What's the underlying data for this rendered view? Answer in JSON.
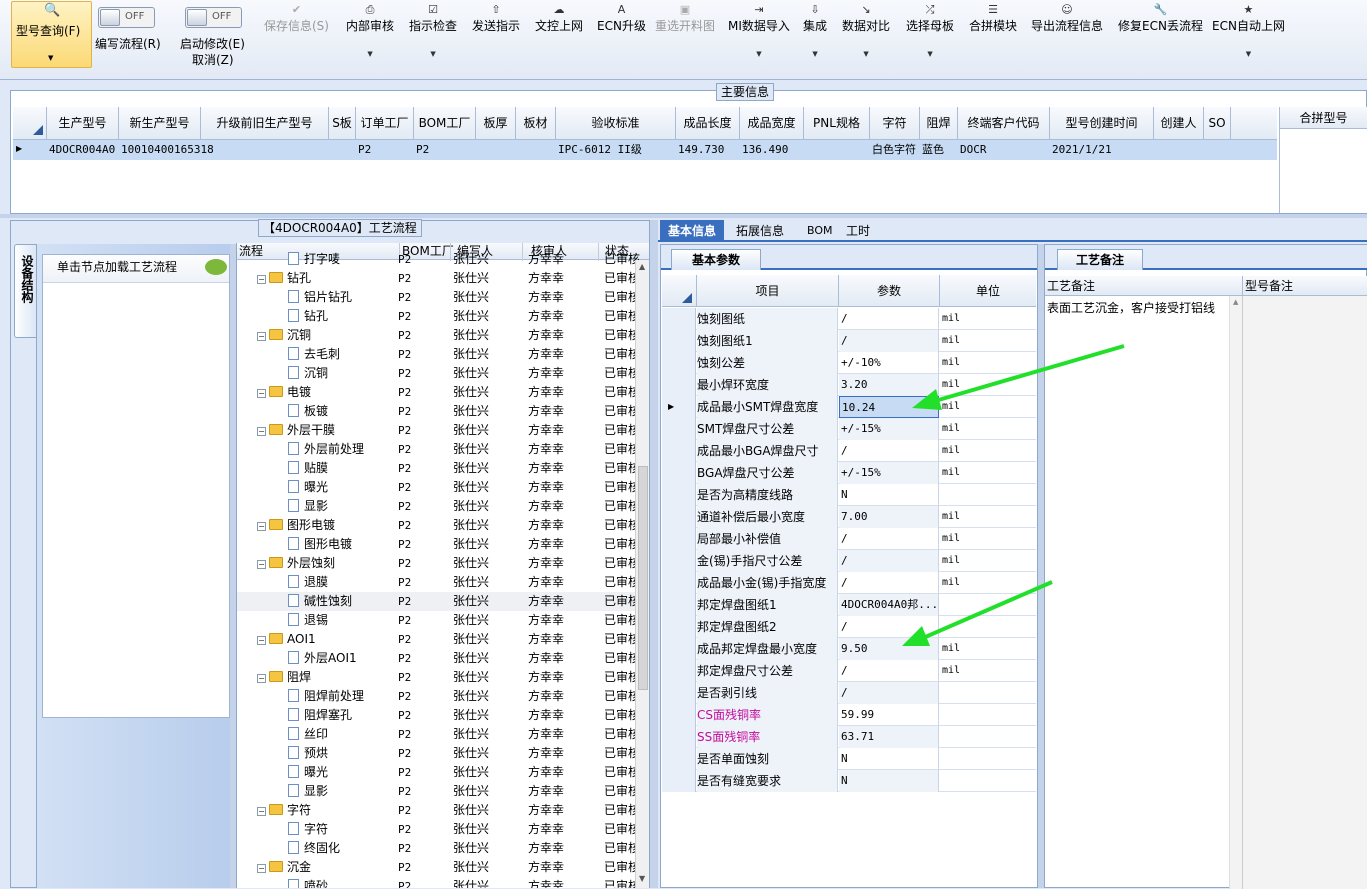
{
  "toolbar": {
    "query": "型号查询(F)",
    "edit_flow": "编写流程(R)",
    "start_modify": "启动修改(E)",
    "cancel": "取消(Z)",
    "toggle_off": "OFF",
    "buttons": [
      "保存信息(S)",
      "内部审核",
      "指示检查",
      "发送指示",
      "文控上网",
      "ECN升级",
      "重选开料图",
      "MI数据导入",
      "集成",
      "数据对比",
      "选择母板",
      "合拼模块",
      "导出流程信息",
      "修复ECN丢流程",
      "ECN自动上网"
    ]
  },
  "main_info": {
    "title": "主要信息",
    "headers": [
      "生产型号",
      "新生产型号",
      "升级前旧生产型号",
      "S板",
      "订单工厂",
      "BOM工厂",
      "板厚",
      "板材",
      "验收标准",
      "成品长度",
      "成品宽度",
      "PNL规格",
      "字符",
      "阻焊",
      "终端客户代码",
      "型号创建时间",
      "创建人",
      "SO"
    ],
    "row": [
      "4DOCR004A0",
      "10010400165318",
      "",
      "",
      "P2",
      "P2",
      "",
      "",
      "IPC-6012 II级",
      "149.730",
      "136.490",
      "",
      "白色字符",
      "蓝色",
      "DOCR",
      "2021/1/21",
      "",
      ""
    ],
    "merge_header": "合拼型号"
  },
  "flow": {
    "title": "【4DOCR004A0】工艺流程",
    "side_tab": "设备结构",
    "hint": "单击节点加载工艺流程",
    "headers": [
      "流程",
      "BOM工厂",
      "编写人",
      "核审人",
      "状态"
    ],
    "rows": [
      {
        "name": "打字唛",
        "type": "doc",
        "factory": "P2",
        "writer": "张仕兴",
        "auditor": "方幸幸",
        "status": "已审核"
      },
      {
        "name": "钻孔",
        "type": "folder",
        "factory": "P2",
        "writer": "张仕兴",
        "auditor": "方幸幸",
        "status": "已审核"
      },
      {
        "name": "铝片钻孔",
        "type": "doc",
        "factory": "P2",
        "writer": "张仕兴",
        "auditor": "方幸幸",
        "status": "已审核"
      },
      {
        "name": "钻孔",
        "type": "doc",
        "factory": "P2",
        "writer": "张仕兴",
        "auditor": "方幸幸",
        "status": "已审核"
      },
      {
        "name": "沉铜",
        "type": "folder",
        "factory": "P2",
        "writer": "张仕兴",
        "auditor": "方幸幸",
        "status": "已审核"
      },
      {
        "name": "去毛刺",
        "type": "doc",
        "factory": "P2",
        "writer": "张仕兴",
        "auditor": "方幸幸",
        "status": "已审核"
      },
      {
        "name": "沉铜",
        "type": "doc",
        "factory": "P2",
        "writer": "张仕兴",
        "auditor": "方幸幸",
        "status": "已审核"
      },
      {
        "name": "电镀",
        "type": "folder",
        "factory": "P2",
        "writer": "张仕兴",
        "auditor": "方幸幸",
        "status": "已审核"
      },
      {
        "name": "板镀",
        "type": "doc",
        "factory": "P2",
        "writer": "张仕兴",
        "auditor": "方幸幸",
        "status": "已审核"
      },
      {
        "name": "外层干膜",
        "type": "folder",
        "factory": "P2",
        "writer": "张仕兴",
        "auditor": "方幸幸",
        "status": "已审核"
      },
      {
        "name": "外层前处理",
        "type": "doc",
        "factory": "P2",
        "writer": "张仕兴",
        "auditor": "方幸幸",
        "status": "已审核"
      },
      {
        "name": "贴膜",
        "type": "doc",
        "factory": "P2",
        "writer": "张仕兴",
        "auditor": "方幸幸",
        "status": "已审核"
      },
      {
        "name": "曝光",
        "type": "doc",
        "factory": "P2",
        "writer": "张仕兴",
        "auditor": "方幸幸",
        "status": "已审核"
      },
      {
        "name": "显影",
        "type": "doc",
        "factory": "P2",
        "writer": "张仕兴",
        "auditor": "方幸幸",
        "status": "已审核"
      },
      {
        "name": "图形电镀",
        "type": "folder",
        "factory": "P2",
        "writer": "张仕兴",
        "auditor": "方幸幸",
        "status": "已审核"
      },
      {
        "name": "图形电镀",
        "type": "doc",
        "factory": "P2",
        "writer": "张仕兴",
        "auditor": "方幸幸",
        "status": "已审核"
      },
      {
        "name": "外层蚀刻",
        "type": "folder",
        "factory": "P2",
        "writer": "张仕兴",
        "auditor": "方幸幸",
        "status": "已审核"
      },
      {
        "name": "退膜",
        "type": "doc",
        "factory": "P2",
        "writer": "张仕兴",
        "auditor": "方幸幸",
        "status": "已审核"
      },
      {
        "name": "碱性蚀刻",
        "type": "doc",
        "factory": "P2",
        "writer": "张仕兴",
        "auditor": "方幸幸",
        "status": "已审核"
      },
      {
        "name": "退锡",
        "type": "doc",
        "factory": "P2",
        "writer": "张仕兴",
        "auditor": "方幸幸",
        "status": "已审核"
      },
      {
        "name": "AOI1",
        "type": "folder",
        "factory": "P2",
        "writer": "张仕兴",
        "auditor": "方幸幸",
        "status": "已审核"
      },
      {
        "name": "外层AOI1",
        "type": "doc",
        "factory": "P2",
        "writer": "张仕兴",
        "auditor": "方幸幸",
        "status": "已审核"
      },
      {
        "name": "阻焊",
        "type": "folder",
        "factory": "P2",
        "writer": "张仕兴",
        "auditor": "方幸幸",
        "status": "已审核"
      },
      {
        "name": "阻焊前处理",
        "type": "doc",
        "factory": "P2",
        "writer": "张仕兴",
        "auditor": "方幸幸",
        "status": "已审核"
      },
      {
        "name": "阻焊塞孔",
        "type": "doc",
        "factory": "P2",
        "writer": "张仕兴",
        "auditor": "方幸幸",
        "status": "已审核"
      },
      {
        "name": "丝印",
        "type": "doc",
        "factory": "P2",
        "writer": "张仕兴",
        "auditor": "方幸幸",
        "status": "已审核"
      },
      {
        "name": "预烘",
        "type": "doc",
        "factory": "P2",
        "writer": "张仕兴",
        "auditor": "方幸幸",
        "status": "已审核"
      },
      {
        "name": "曝光",
        "type": "doc",
        "factory": "P2",
        "writer": "张仕兴",
        "auditor": "方幸幸",
        "status": "已审核"
      },
      {
        "name": "显影",
        "type": "doc",
        "factory": "P2",
        "writer": "张仕兴",
        "auditor": "方幸幸",
        "status": "已审核"
      },
      {
        "name": "字符",
        "type": "folder",
        "factory": "P2",
        "writer": "张仕兴",
        "auditor": "方幸幸",
        "status": "已审核"
      },
      {
        "name": "字符",
        "type": "doc",
        "factory": "P2",
        "writer": "张仕兴",
        "auditor": "方幸幸",
        "status": "已审核"
      },
      {
        "name": "终固化",
        "type": "doc",
        "factory": "P2",
        "writer": "张仕兴",
        "auditor": "方幸幸",
        "status": "已审核"
      },
      {
        "name": "沉金",
        "type": "folder",
        "factory": "P2",
        "writer": "张仕兴",
        "auditor": "方幸幸",
        "status": "已审核"
      },
      {
        "name": "喷砂",
        "type": "doc",
        "factory": "P2",
        "writer": "张仕兴",
        "auditor": "方幸幸",
        "status": "已审核"
      }
    ]
  },
  "detail": {
    "tabs": [
      "基本信息",
      "拓展信息",
      "BOM",
      "工时"
    ],
    "subtab": "基本参数",
    "headers": [
      "项目",
      "参数",
      "单位"
    ],
    "rows": [
      {
        "item": "蚀刻图纸",
        "value": "/",
        "unit": "mil"
      },
      {
        "item": "蚀刻图纸1",
        "value": "/",
        "unit": "mil"
      },
      {
        "item": "蚀刻公差",
        "value": "+/-10%",
        "unit": "mil"
      },
      {
        "item": "最小焊环宽度",
        "value": "3.20",
        "unit": "mil"
      },
      {
        "item": "成品最小SMT焊盘宽度",
        "value": "10.24",
        "unit": "mil"
      },
      {
        "item": "SMT焊盘尺寸公差",
        "value": "+/-15%",
        "unit": "mil"
      },
      {
        "item": "成品最小BGA焊盘尺寸",
        "value": "/",
        "unit": "mil"
      },
      {
        "item": "BGA焊盘尺寸公差",
        "value": "+/-15%",
        "unit": "mil"
      },
      {
        "item": "是否为高精度线路",
        "value": "N",
        "unit": ""
      },
      {
        "item": "通道补偿后最小宽度",
        "value": "7.00",
        "unit": "mil"
      },
      {
        "item": "局部最小补偿值",
        "value": "/",
        "unit": "mil"
      },
      {
        "item": "金(锡)手指尺寸公差",
        "value": "/",
        "unit": "mil"
      },
      {
        "item": "成品最小金(锡)手指宽度",
        "value": "/",
        "unit": "mil"
      },
      {
        "item": "邦定焊盘图纸1",
        "value": "4DOCR004A0邦...",
        "unit": ""
      },
      {
        "item": "邦定焊盘图纸2",
        "value": "/",
        "unit": ""
      },
      {
        "item": "成品邦定焊盘最小宽度",
        "value": "9.50",
        "unit": "mil"
      },
      {
        "item": "邦定焊盘尺寸公差",
        "value": "/",
        "unit": "mil"
      },
      {
        "item": "是否剥引线",
        "value": "/",
        "unit": ""
      },
      {
        "item": "CS面残铜率",
        "value": "59.99",
        "unit": ""
      },
      {
        "item": "SS面残铜率",
        "value": "63.71",
        "unit": ""
      },
      {
        "item": "是否单面蚀刻",
        "value": "N",
        "unit": ""
      },
      {
        "item": "是否有缝宽要求",
        "value": "N",
        "unit": ""
      }
    ]
  },
  "remark": {
    "tab": "工艺备注",
    "col1": "工艺备注",
    "col2": "型号备注",
    "text": "表面工艺沉金，客户接受打铝线"
  },
  "colors": {
    "accent": "#3a6fc0",
    "arrow": "#22e02a",
    "highlight": "#c40c9c"
  }
}
